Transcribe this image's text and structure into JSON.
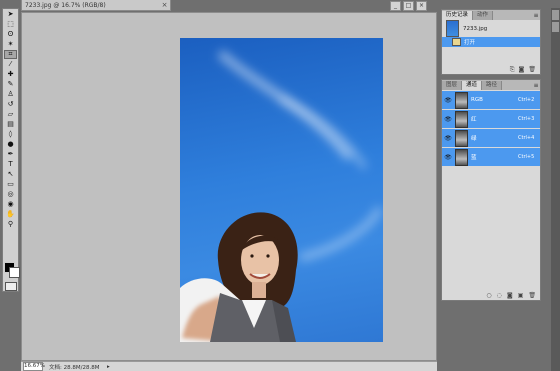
{
  "document": {
    "tab_title": "7233.jpg @ 16.7% (RGB/8)",
    "close_glyph": "×",
    "window_buttons": [
      "_",
      "□",
      "×"
    ]
  },
  "status_bar": {
    "zoom": "16.67%",
    "doc_size": "文档: 28.8M/28.8M",
    "nav_arrow": "▸"
  },
  "tools": [
    {
      "name": "move-tool-icon",
      "glyph": "➤"
    },
    {
      "name": "marquee-tool-icon",
      "glyph": "⬚"
    },
    {
      "name": "lasso-tool-icon",
      "glyph": "ʘ"
    },
    {
      "name": "magic-wand-tool-icon",
      "glyph": "✶"
    },
    {
      "name": "crop-tool-icon",
      "glyph": "⌗"
    },
    {
      "name": "eyedropper-tool-icon",
      "glyph": "⁄"
    },
    {
      "name": "healing-brush-tool-icon",
      "glyph": "✚"
    },
    {
      "name": "brush-tool-icon",
      "glyph": "✎"
    },
    {
      "name": "clone-stamp-tool-icon",
      "glyph": "♙"
    },
    {
      "name": "history-brush-tool-icon",
      "glyph": "↺"
    },
    {
      "name": "eraser-tool-icon",
      "glyph": "▱"
    },
    {
      "name": "gradient-tool-icon",
      "glyph": "▤"
    },
    {
      "name": "blur-tool-icon",
      "glyph": "◊"
    },
    {
      "name": "dodge-tool-icon",
      "glyph": "●"
    },
    {
      "name": "pen-tool-icon",
      "glyph": "✒"
    },
    {
      "name": "type-tool-icon",
      "glyph": "T"
    },
    {
      "name": "path-selection-tool-icon",
      "glyph": "↖"
    },
    {
      "name": "shape-tool-icon",
      "glyph": "▭"
    },
    {
      "name": "3d-rotate-tool-icon",
      "glyph": "◎"
    },
    {
      "name": "3d-orbit-tool-icon",
      "glyph": "◉"
    },
    {
      "name": "hand-tool-icon",
      "glyph": "✋"
    },
    {
      "name": "zoom-tool-icon",
      "glyph": "⚲"
    }
  ],
  "history_panel": {
    "tabs": [
      "历史记录",
      "动作"
    ],
    "menu_glyph": "≡",
    "snapshot_label": "7233.jpg",
    "state_label": "打开",
    "footer_icons": [
      "⎘",
      "◙",
      "🗑"
    ]
  },
  "channels_panel": {
    "tabs": [
      "图层",
      "通道",
      "路径"
    ],
    "menu_glyph": "≡",
    "eye_glyph": "👁",
    "channels": [
      {
        "name": "RGB",
        "shortcut": "Ctrl+2"
      },
      {
        "name": "红",
        "shortcut": "Ctrl+3"
      },
      {
        "name": "绿",
        "shortcut": "Ctrl+4"
      },
      {
        "name": "蓝",
        "shortcut": "Ctrl+5"
      }
    ],
    "footer_icons": [
      "○",
      "◌",
      "◙",
      "▣",
      "🗑"
    ]
  },
  "colors": {
    "selection_blue": "#4c99ef",
    "canvas_gray": "#c0c0c0",
    "app_background": "#6f6f6f"
  }
}
